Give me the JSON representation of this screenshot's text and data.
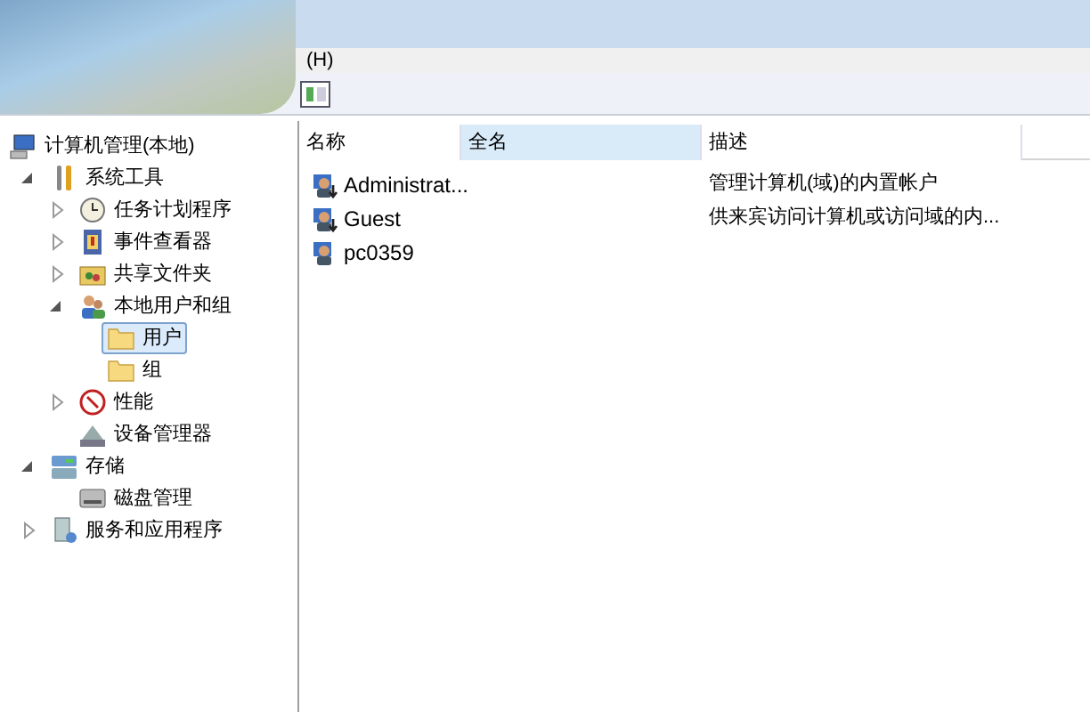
{
  "menu_bar": {
    "items": [
      "(H)"
    ]
  },
  "tree": [
    {
      "label": "计算机管理(本地)",
      "kind": "computer",
      "selected": false,
      "children": [
        {
          "label": "系统工具",
          "kind": "tools",
          "expanded": true,
          "selected": false,
          "children": [
            {
              "label": "任务计划程序",
              "kind": "clock",
              "expanded": false,
              "selected": false
            },
            {
              "label": "事件查看器",
              "kind": "event",
              "expanded": false,
              "selected": false
            },
            {
              "label": "共享文件夹",
              "kind": "share",
              "expanded": false,
              "selected": false
            },
            {
              "label": "本地用户和组",
              "kind": "users",
              "expanded": true,
              "selected": false,
              "children": [
                {
                  "label": "用户",
                  "kind": "folder",
                  "selected": true
                },
                {
                  "label": "组",
                  "kind": "folder",
                  "selected": false
                }
              ]
            },
            {
              "label": "性能",
              "kind": "perf",
              "expanded": false,
              "selected": false
            },
            {
              "label": "设备管理器",
              "kind": "device",
              "selected": false
            }
          ]
        },
        {
          "label": "存储",
          "kind": "storage",
          "expanded": true,
          "selected": false,
          "children": [
            {
              "label": "磁盘管理",
              "kind": "disk",
              "selected": false
            }
          ]
        },
        {
          "label": "服务和应用程序",
          "kind": "services",
          "expanded": false,
          "selected": false
        }
      ]
    }
  ],
  "table": {
    "columns": [
      {
        "label": "名称",
        "hovered": false
      },
      {
        "label": "全名",
        "hovered": true
      },
      {
        "label": "描述",
        "hovered": false
      }
    ],
    "rows": [
      {
        "name": "Administrat...",
        "disabled": true,
        "description": "管理计算机(域)的内置帐户"
      },
      {
        "name": "Guest",
        "disabled": true,
        "description": "供来宾访问计算机或访问域的内..."
      },
      {
        "name": "pc0359",
        "disabled": false
      }
    ]
  }
}
